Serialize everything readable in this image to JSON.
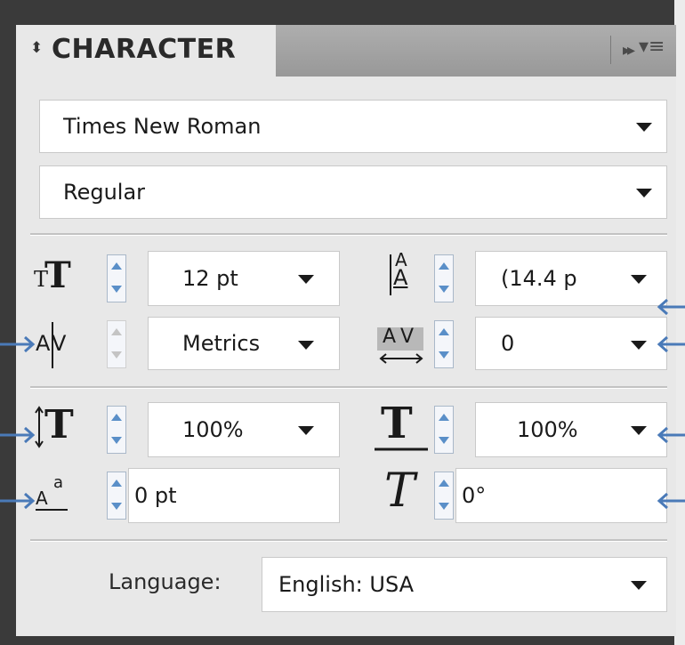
{
  "panel": {
    "tab_arrows": "⬍",
    "title": "CHARACTER",
    "collapse_glyph": "▸▸",
    "menu_glyph": "▾≡"
  },
  "font_family": {
    "value": "Times New Roman"
  },
  "font_style": {
    "value": "Regular"
  },
  "font_size": {
    "value": "12 pt",
    "icon": "font-size-icon"
  },
  "leading": {
    "value": "(14.4 p",
    "icon": "leading-icon"
  },
  "kerning": {
    "value": "Metrics",
    "icon": "kerning-icon"
  },
  "tracking": {
    "value": "0",
    "icon": "tracking-icon"
  },
  "vertical_scale": {
    "value": "100%",
    "icon": "vertical-scale-icon"
  },
  "horizontal_scale": {
    "value": "100%",
    "icon": "horizontal-scale-icon"
  },
  "baseline_shift": {
    "value": "0 pt",
    "icon": "baseline-shift-icon"
  },
  "skew": {
    "value": "0°",
    "icon": "skew-icon"
  },
  "language": {
    "label": "Language:",
    "value": "English: USA"
  },
  "annotation": {
    "arrow_color": "#4a7ab8"
  }
}
